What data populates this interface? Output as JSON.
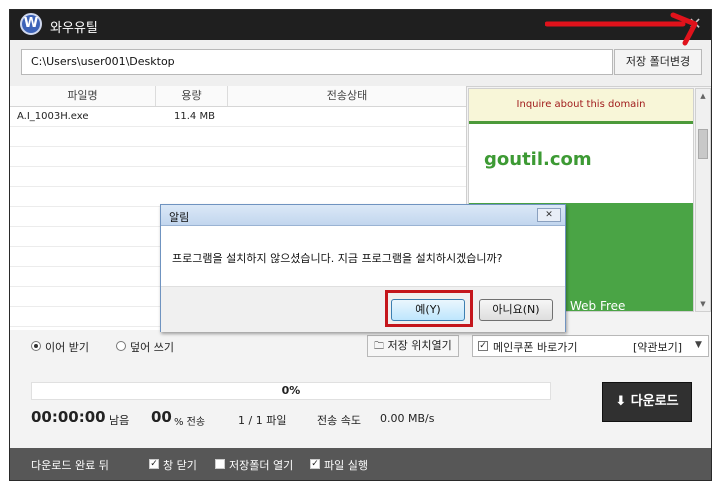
{
  "window": {
    "title": "와우유틸",
    "logo_letter": "W",
    "minimize_glyph": "—",
    "close_glyph": "✕"
  },
  "path": {
    "value": "C:\\Users\\user001\\Desktop",
    "change_folder_label": "저장 폴더변경"
  },
  "file_table": {
    "columns": [
      "파일명",
      "용량",
      "전송상태"
    ],
    "rows": [
      {
        "name": "A.I_1003H.exe",
        "size": "11.4 MB",
        "status": ""
      }
    ]
  },
  "ad": {
    "inquire_text": "Inquire about this domain",
    "domain": "goutil.com",
    "green_text": "Web Free"
  },
  "options": {
    "resume_label": "이어 받기",
    "overwrite_label": "덮어 쓰기",
    "open_location_label": "저장 위치열기",
    "coupon_label": "메인쿠폰 바로가기",
    "terms_label": "[약관보기]"
  },
  "progress": {
    "percent": 0,
    "percent_text": "0%",
    "time_remaining": "00:00:00",
    "time_suffix": "남음",
    "transfer_percent": "00",
    "transfer_suffix": "% 전송",
    "file_count": "1 / 1 파일",
    "speed_label": "전송 속도",
    "speed_value": "0.00 MB/s"
  },
  "download_button_label": "다운로드",
  "footer": {
    "after_done_label": "다운로드 완료 뒤",
    "close_window_label": "창 닫기",
    "open_folder_label": "저장폴더 열기",
    "run_file_label": "파일 실행"
  },
  "dialog": {
    "title": "알림",
    "message": "프로그램을 설치하지 않으셨습니다. 지금 프로그램을 설치하시겠습니까?",
    "yes_label": "예(Y)",
    "no_label": "아니요(N)"
  },
  "colors": {
    "annotation_red": "#e0121b",
    "titlebar": "#1f1f1f",
    "ad_green": "#4aa445"
  }
}
